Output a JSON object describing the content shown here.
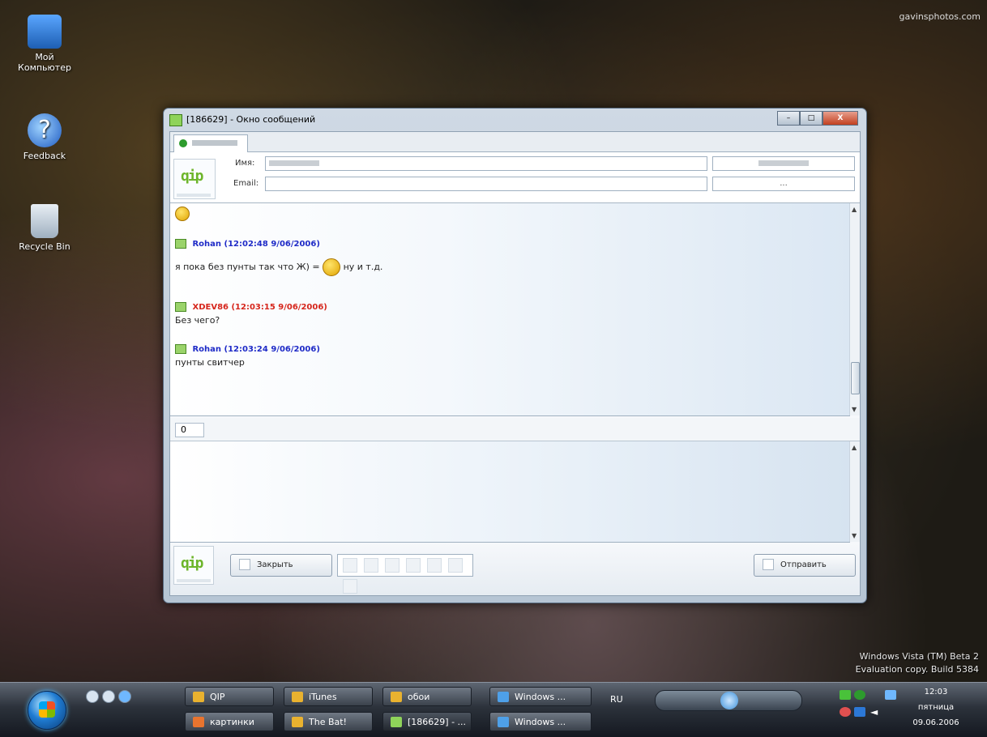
{
  "site_watermark": "gavinsphotos.com",
  "desktop_icons": [
    {
      "label": "Мой Компьютер",
      "icon": "computer-icon"
    },
    {
      "label": "Feedback",
      "icon": "feedback-icon"
    },
    {
      "label": "Recycle Bin",
      "icon": "recycle-bin-icon"
    }
  ],
  "window": {
    "title": "[186629] - Окно сообщений",
    "buttons": [
      "minimize",
      "maximize",
      "close"
    ],
    "close_glyph": "X",
    "contact": {
      "name_label": "Имя:",
      "email_label": "Email:",
      "ellipsis": "..."
    },
    "messages": [
      {
        "author": "Rohan",
        "timestamp": "(12:02:48 9/06/2006)",
        "text_before": "я пока без пунты так что Ж) =",
        "text_after": "ну и т.д.",
        "color": "#1f2bc7"
      },
      {
        "author": "XDEV86",
        "timestamp": "(12:03:15 9/06/2006)",
        "text": "Без чего?",
        "color": "#d6261c"
      },
      {
        "author": "Rohan",
        "timestamp": "(12:03:24 9/06/2006)",
        "text": "пунты свитчер",
        "color": "#1f2bc7"
      }
    ],
    "char_counter": "0",
    "close_button": "Закрыть",
    "send_button": "Отправить"
  },
  "vista_watermark": {
    "line1": "Windows Vista (TM) Beta 2",
    "line2": "Evaluation copy. Build 5384"
  },
  "taskbar": {
    "buttons_row1": [
      "QIP",
      "iTunes",
      "обои",
      "Windows ..."
    ],
    "buttons_row2": [
      "картинки",
      "The Bat!",
      "[186629] - ...",
      "Windows ..."
    ],
    "language": "RU",
    "clock": {
      "time": "12:03",
      "day": "пятница",
      "date": "09.06.2006"
    }
  }
}
